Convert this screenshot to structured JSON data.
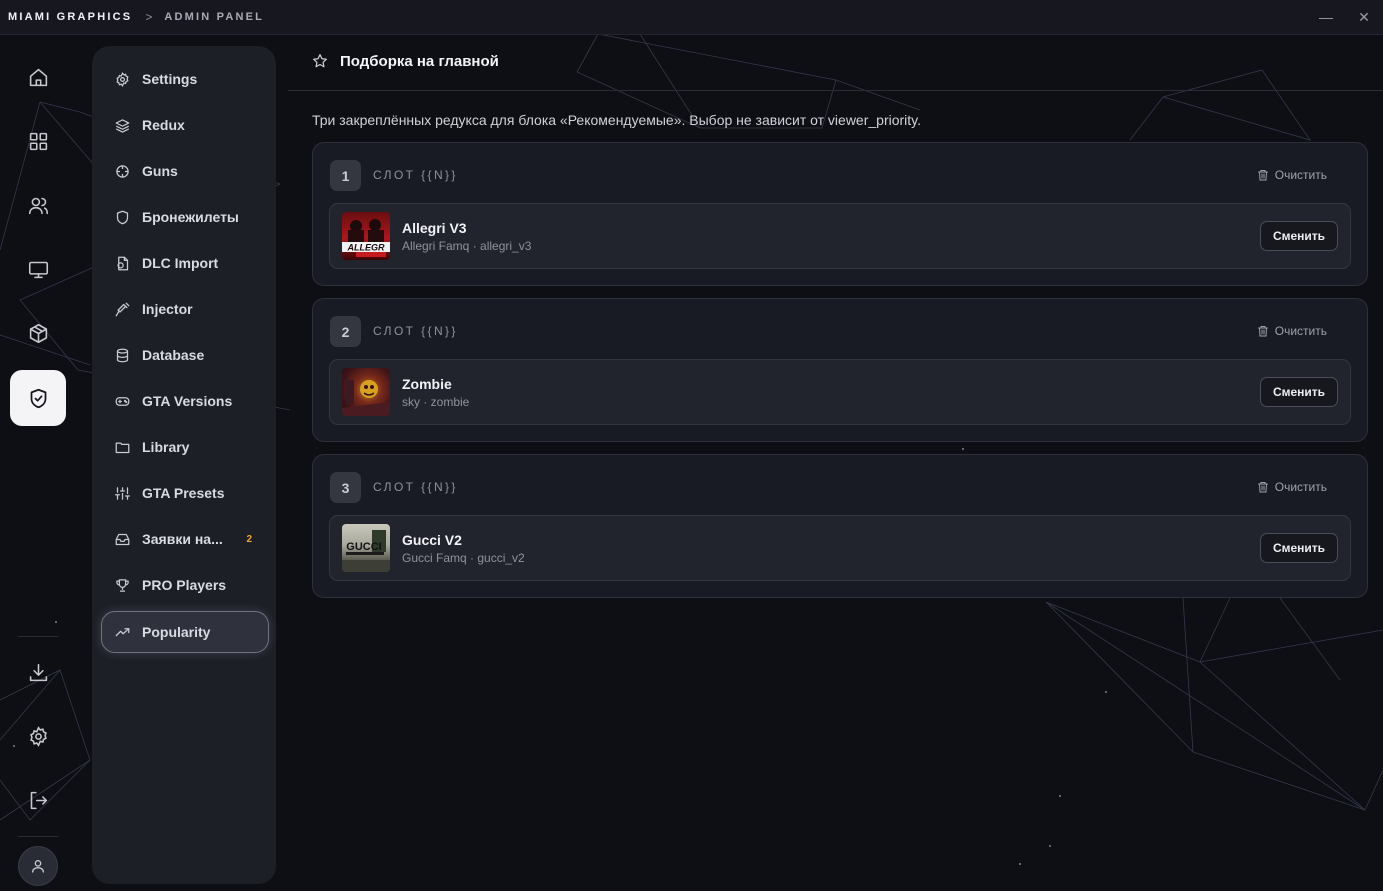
{
  "titlebar": {
    "brand": "MIAMI GRAPHICS",
    "separator": ">",
    "crumb": "ADMIN PANEL",
    "minimize": "—",
    "close": "✕"
  },
  "rail": {
    "items": [
      "home-icon",
      "grid-icon",
      "users-icon",
      "monitor-icon",
      "box-icon",
      "shield-check-icon"
    ],
    "active": "shield-check-icon",
    "bottom": [
      "download-icon",
      "gear-icon",
      "logout-icon"
    ],
    "avatar": "user-icon"
  },
  "nav": {
    "items": [
      {
        "label": "Settings",
        "icon": "gear-icon"
      },
      {
        "label": "Redux",
        "icon": "layers-icon"
      },
      {
        "label": "Guns",
        "icon": "crosshair-icon"
      },
      {
        "label": "Бронежилеты",
        "icon": "shield-icon"
      },
      {
        "label": "DLC Import",
        "icon": "file-import-icon"
      },
      {
        "label": "Injector",
        "icon": "syringe-icon"
      },
      {
        "label": "Database",
        "icon": "database-icon"
      },
      {
        "label": "GTA Versions",
        "icon": "gamepad-icon"
      },
      {
        "label": "Library",
        "icon": "folder-icon"
      },
      {
        "label": "GTA Presets",
        "icon": "sliders-icon"
      },
      {
        "label": "Заявки на...",
        "icon": "inbox-icon",
        "badge": "2"
      },
      {
        "label": "PRO Players",
        "icon": "trophy-icon"
      },
      {
        "label": "Popularity",
        "icon": "trending-up-icon"
      }
    ],
    "active": "Popularity",
    "badge_color": "#f0a531"
  },
  "page": {
    "title": "Подборка на главной",
    "description": "Три закреплённых редукса для блока «Рекомендуемые». Выбор не зависит от viewer_priority.",
    "slots": [
      {
        "number": "1",
        "label": "СЛОТ {{N}}",
        "clear_label": "Очистить",
        "item": {
          "name": "Allegri V3",
          "sub": "Allegri Famq · allegri_v3",
          "thumb_text": "ALLEGR"
        },
        "change_label": "Сменить"
      },
      {
        "number": "2",
        "label": "СЛОТ {{N}}",
        "clear_label": "Очистить",
        "item": {
          "name": "Zombie",
          "sub": "sky · zombie",
          "thumb_text": ""
        },
        "change_label": "Сменить"
      },
      {
        "number": "3",
        "label": "СЛОТ {{N}}",
        "clear_label": "Очистить",
        "item": {
          "name": "Gucci V2",
          "sub": "Gucci Famq · gucci_v2",
          "thumb_text": "GUCCI"
        },
        "change_label": "Сменить"
      }
    ]
  },
  "colors": {
    "background": "#0e0f14",
    "panel": "#1d1f27",
    "accent_active": "#f4f4f6"
  }
}
